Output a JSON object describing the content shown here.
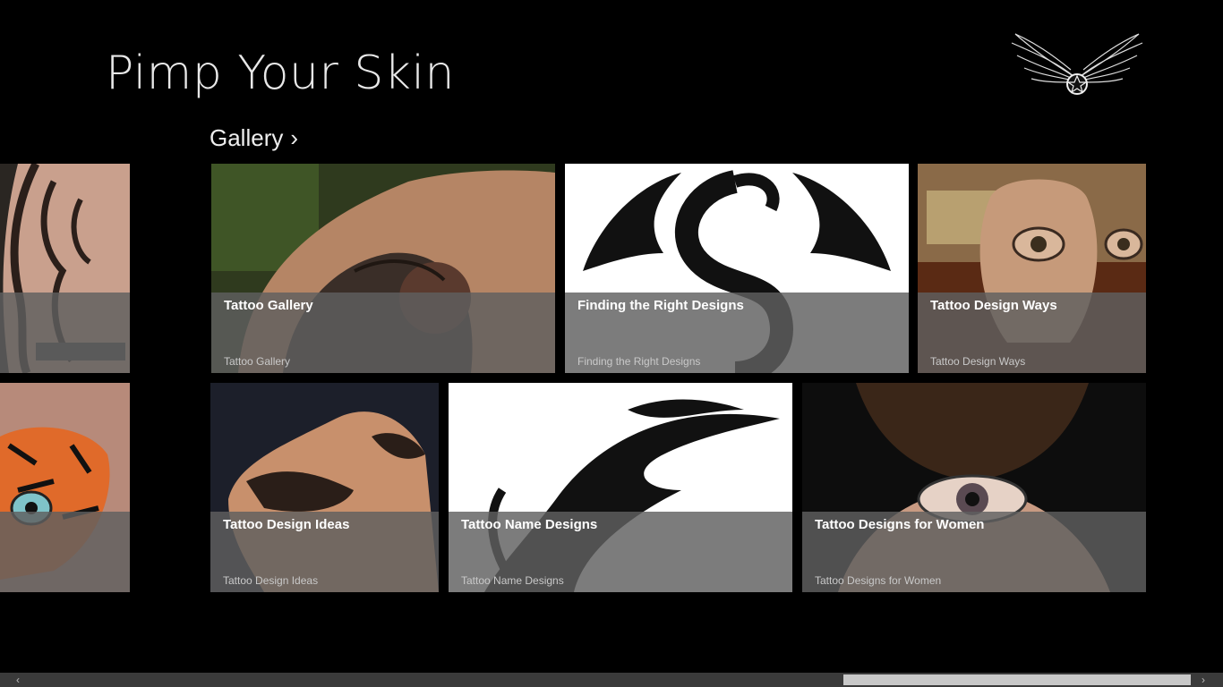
{
  "app": {
    "title": "Pimp Your Skin"
  },
  "section": {
    "title": "Gallery",
    "chevron": "›"
  },
  "tiles": [
    {
      "title": "",
      "subtitle": "",
      "image": "tribal-sleeve-torso"
    },
    {
      "title": "Tattoo Gallery",
      "subtitle": "Tattoo Gallery",
      "image": "dragon-shoulder-chest"
    },
    {
      "title": "Finding the Right Designs",
      "subtitle": "Finding the Right Designs",
      "image": "black-dragon-silhouette"
    },
    {
      "title": "Tattoo Design Ways",
      "subtitle": "Tattoo Design Ways",
      "image": "eyes-on-hands"
    },
    {
      "title": "",
      "subtitle": "",
      "image": "tiger-face"
    },
    {
      "title": "Tattoo Design Ideas",
      "subtitle": "Tattoo Design Ideas",
      "image": "tribal-arm-back"
    },
    {
      "title": "Tattoo Name Designs",
      "subtitle": "Tattoo Name Designs",
      "image": "tribal-dragon-head"
    },
    {
      "title": "Tattoo Designs for Women",
      "subtitle": "Tattoo Designs for Women",
      "image": "eye-on-neck"
    }
  ],
  "scrollbar": {
    "left_arrow": "‹",
    "right_arrow": "›",
    "position": 0.72
  },
  "colors": {
    "background": "#000000",
    "overlay": "#5f5f5f",
    "scroll_track": "#3a3a3a",
    "scroll_thumb": "#c8c8c8"
  }
}
